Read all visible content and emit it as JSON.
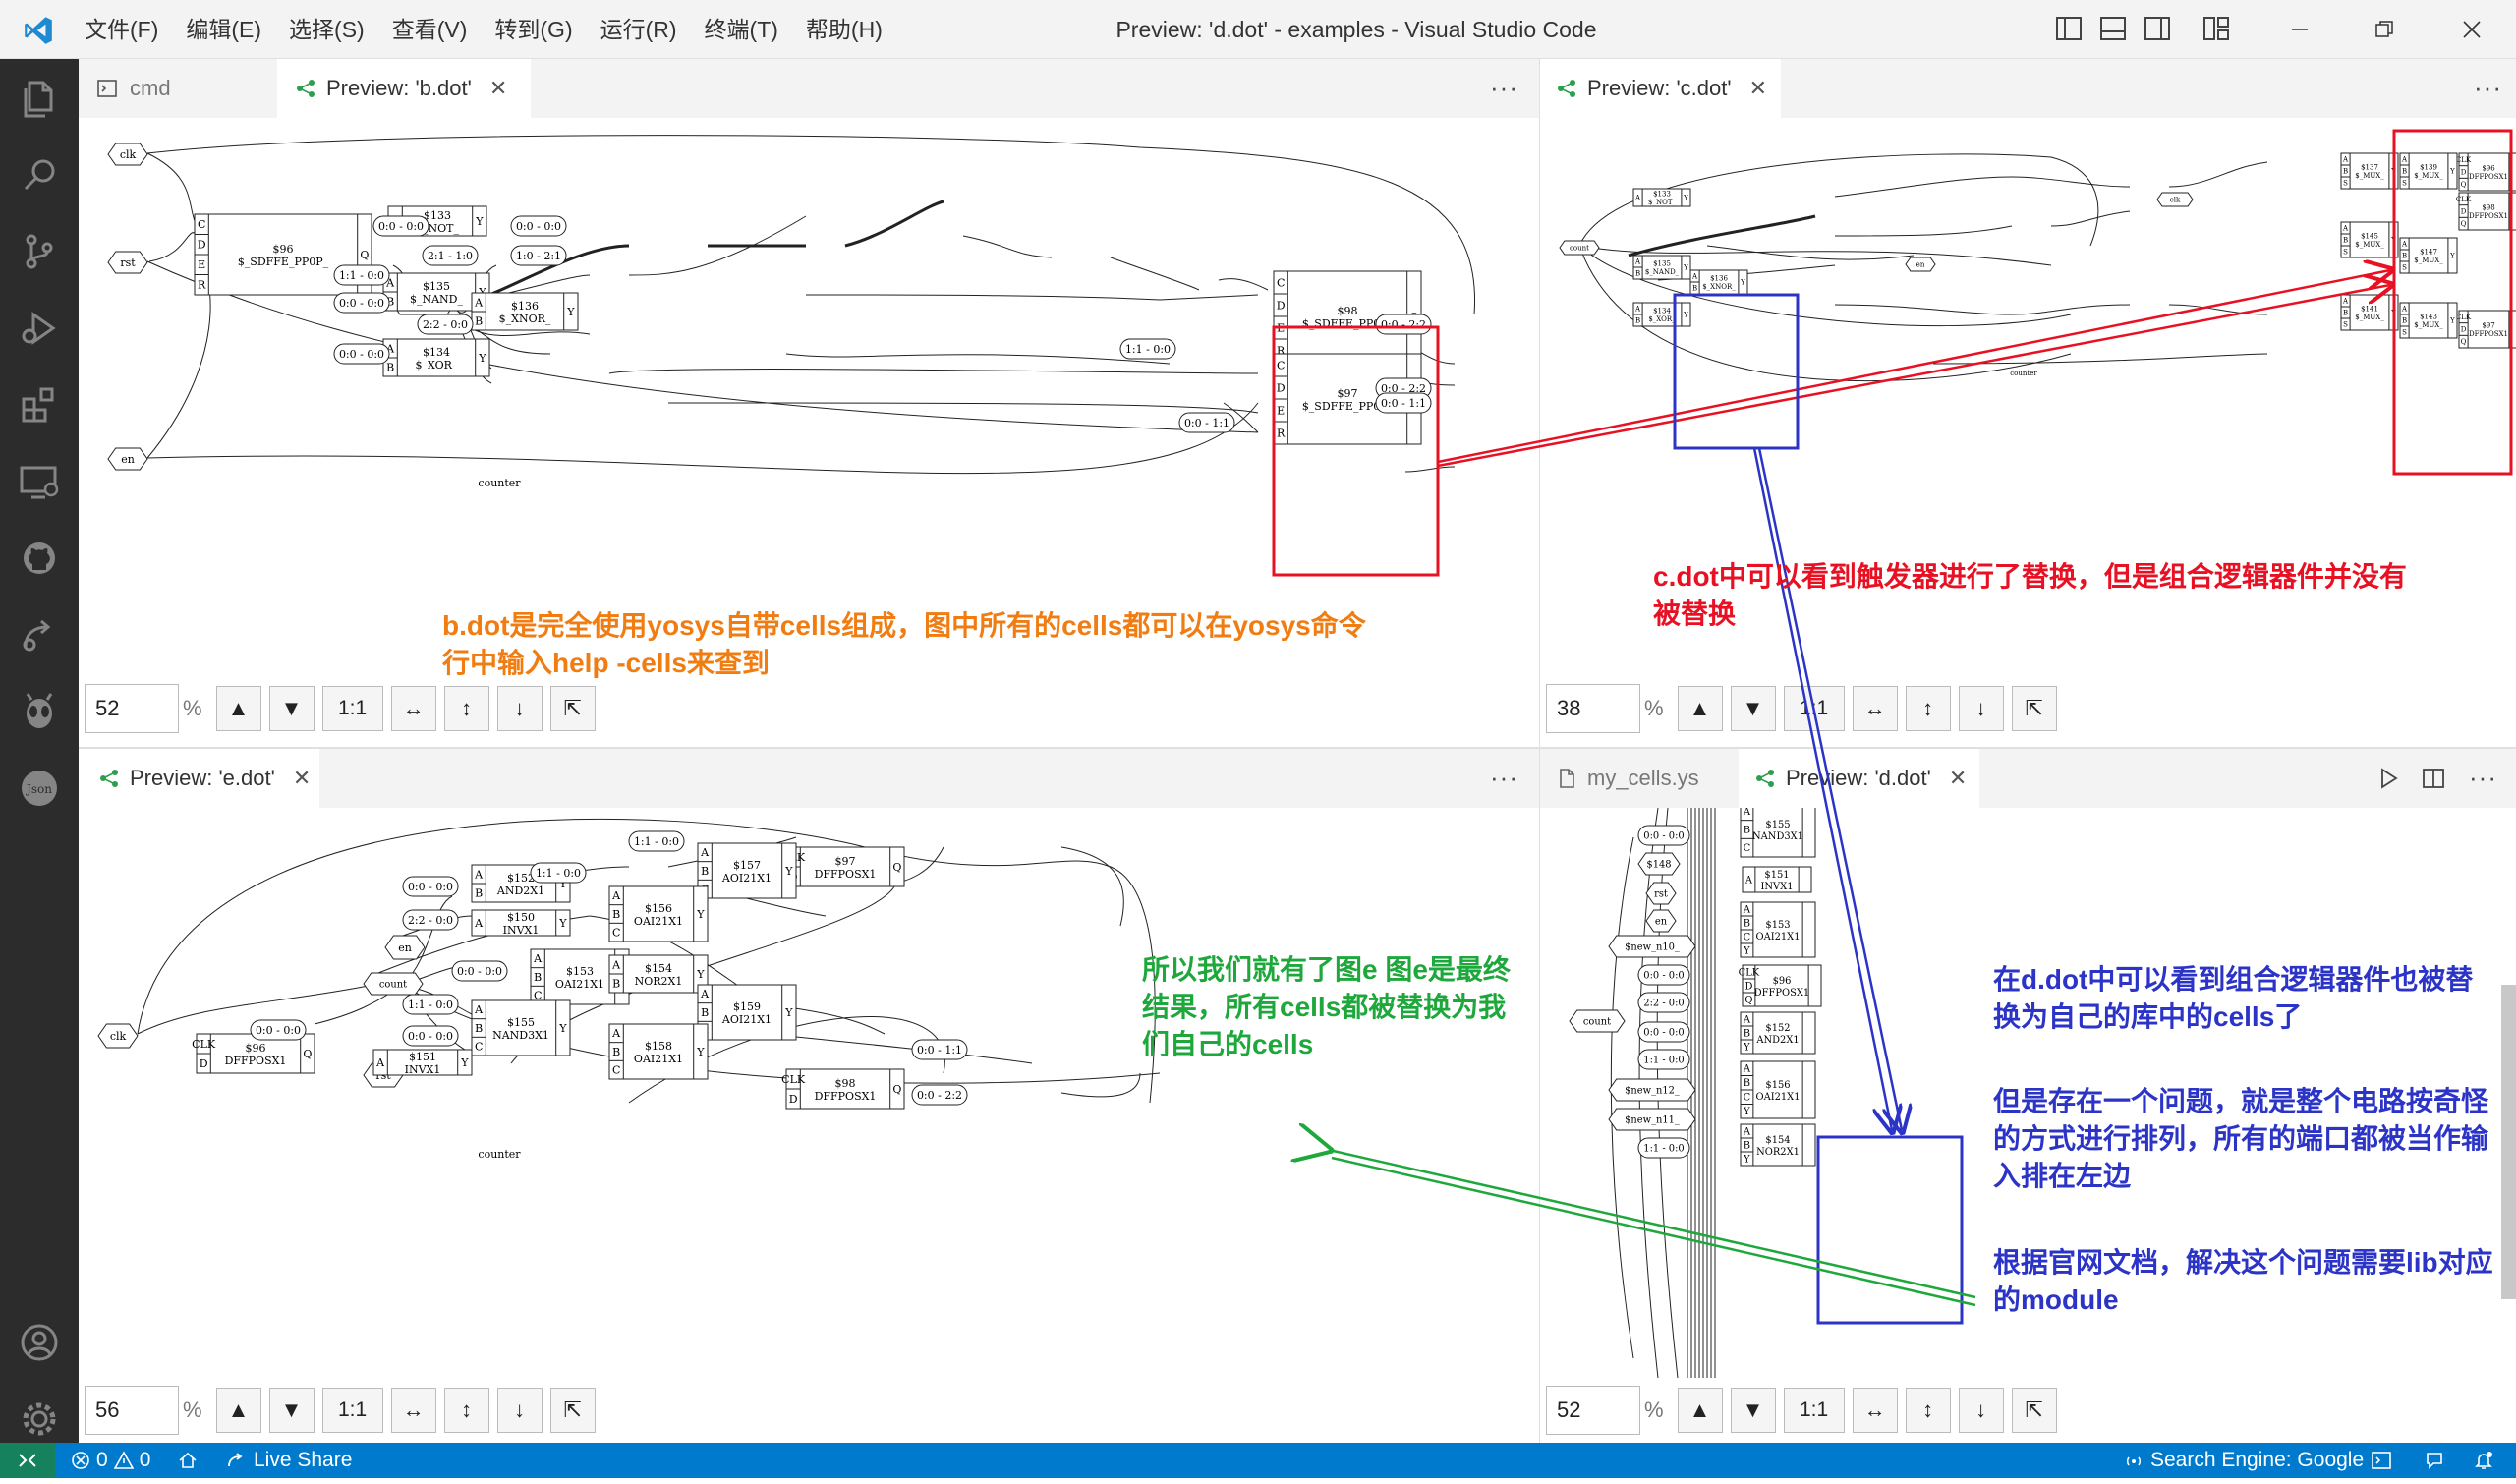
{
  "window": {
    "title": "Preview: 'd.dot' - examples - Visual Studio Code",
    "menu": [
      "文件(F)",
      "编辑(E)",
      "选择(S)",
      "查看(V)",
      "转到(G)",
      "运行(R)",
      "终端(T)",
      "帮助(H)"
    ]
  },
  "tabs": {
    "top_left": [
      {
        "label": "cmd"
      },
      {
        "label": "Preview: 'b.dot'"
      }
    ],
    "top_right": [
      {
        "label": "Preview: 'c.dot'"
      }
    ],
    "bottom_left": [
      {
        "label": "Preview: 'e.dot'"
      }
    ],
    "bottom_right": [
      {
        "label": "my_cells.ys"
      },
      {
        "label": "Preview: 'd.dot'"
      }
    ]
  },
  "controls": {
    "zoom_b": "52",
    "zoom_c": "38",
    "zoom_e": "56",
    "zoom_d": "52",
    "pct": "%",
    "one_to_one": "1:1"
  },
  "annotations": {
    "b_note": "b.dot是完全使用yosys自带cells组成，图中所有的cells都可以在yosys命令行中输入help -cells来查到",
    "c_note": "c.dot中可以看到触发器进行了替换，但是组合逻辑器件并没有被替换",
    "e_note": "所以我们就有了图e 图e是最终结果，所有cells都被替换为我们自己的cells",
    "d_note1": "在d.dot中可以看到组合逻辑器件也被替换为自己的库中的cells了",
    "d_note2": "但是存在一个问题，就是整个电路按奇怪的方式进行排列，所有的端口都被当作输入排在左边",
    "d_note3": "根据官网文档，解决这个问题需要lib对应的module"
  },
  "colors": {
    "orange": "#f07c12",
    "red": "#e81123",
    "blue": "#2b34c7",
    "green": "#1ea83c",
    "status": "#007acc"
  },
  "diagram_b": {
    "caption": "counter",
    "ports": [
      "clk",
      "rst",
      "en",
      "count"
    ],
    "cells": [
      {
        "id": "$96",
        "type": "$_SDFFE_PP0P_"
      },
      {
        "id": "$133",
        "type": "$_NOT_"
      },
      {
        "id": "$135",
        "type": "$_NAND_"
      },
      {
        "id": "$136",
        "type": "$_XNOR_"
      },
      {
        "id": "$134",
        "type": "$_XOR_"
      },
      {
        "id": "$98",
        "type": "$_SDFFE_PP0P_"
      },
      {
        "id": "$97",
        "type": "$_SDFFE_PP0P_"
      }
    ],
    "nets": [
      "0:0 - 0:0",
      "2:1 - 1:0",
      "1:0 - 2:1",
      "0:0 - 0:0",
      "1:1 - 0:0",
      "0:0 - 0:0",
      "2:2 - 0:0",
      "0:0 - 2:2",
      "1:1 - 0:0",
      "0:0 - 1:1",
      "0:0 - 0:0",
      "0:0 - 2:2",
      "0:0 - 1:1"
    ]
  },
  "diagram_c": {
    "caption": "counter",
    "ports": [
      "count",
      "clk",
      "en"
    ],
    "cells": [
      {
        "id": "$96",
        "type": "DFFPOSX1"
      },
      {
        "id": "$98",
        "type": "DFFPOSX1"
      },
      {
        "id": "$97",
        "type": "DFFPOSX1"
      },
      {
        "id": "$133",
        "type": "$_NOT_"
      },
      {
        "id": "$135",
        "type": "$_NAND_"
      },
      {
        "id": "$136",
        "type": "$_XNOR_"
      },
      {
        "id": "$134",
        "type": "$_XOR_"
      },
      {
        "id": "$137",
        "type": "$_MUX_"
      },
      {
        "id": "$139",
        "type": "$_MUX_"
      },
      {
        "id": "$145",
        "type": "$_MUX_"
      },
      {
        "id": "$147",
        "type": "$_MUX_"
      },
      {
        "id": "$141",
        "type": "$_MUX_"
      },
      {
        "id": "$143",
        "type": "$_MUX_"
      }
    ]
  },
  "diagram_e": {
    "caption": "counter",
    "ports": [
      "clk",
      "en",
      "count",
      "rst"
    ],
    "cells": [
      {
        "id": "$96",
        "type": "DFFPOSX1"
      },
      {
        "id": "$97",
        "type": "DFFPOSX1"
      },
      {
        "id": "$98",
        "type": "DFFPOSX1"
      },
      {
        "id": "$152",
        "type": "AND2X1"
      },
      {
        "id": "$150",
        "type": "INVX1"
      },
      {
        "id": "$157",
        "type": "AOI21X1"
      },
      {
        "id": "$156",
        "type": "OAI21X1"
      },
      {
        "id": "$153",
        "type": "OAI21X1"
      },
      {
        "id": "$154",
        "type": "NOR2X1"
      },
      {
        "id": "$155",
        "type": "NAND3X1"
      },
      {
        "id": "$159",
        "type": "AOI21X1"
      },
      {
        "id": "$158",
        "type": "OAI21X1"
      },
      {
        "id": "$151",
        "type": "INVX1"
      }
    ],
    "nets": [
      "1:1 - 0:0",
      "1:1 - 0:0",
      "0:0 - 0:0",
      "2:2 - 0:0",
      "0:0 - 0:0",
      "1:1 - 0:0",
      "0:0 - 0:0",
      "0:0 - 0:0",
      "0:0 - 1:1",
      "0:0 - 2:2"
    ]
  },
  "diagram_d": {
    "ports": [
      "$148",
      "rst",
      "en",
      "$new_n10_",
      "count",
      "$new_n12_",
      "$new_n11_"
    ],
    "cells": [
      {
        "id": "$155",
        "type": "NAND3X1"
      },
      {
        "id": "$151",
        "type": "INVX1"
      },
      {
        "id": "$153",
        "type": "OAI21X1"
      },
      {
        "id": "$96",
        "type": "DFFPOSX1"
      },
      {
        "id": "$152",
        "type": "AND2X1"
      },
      {
        "id": "$156",
        "type": "OAI21X1"
      },
      {
        "id": "$154",
        "type": "NOR2X1"
      }
    ],
    "nets": [
      "0:0 - 0:0",
      "0:0 - 0:0",
      "2:2 - 0:0",
      "0:0 - 0:0",
      "1:1 - 0:0",
      "1:1 - 0:0"
    ]
  },
  "status": {
    "errors": "0",
    "warnings": "0",
    "live_share": "Live Share",
    "search_engine": "Search Engine: Google"
  }
}
